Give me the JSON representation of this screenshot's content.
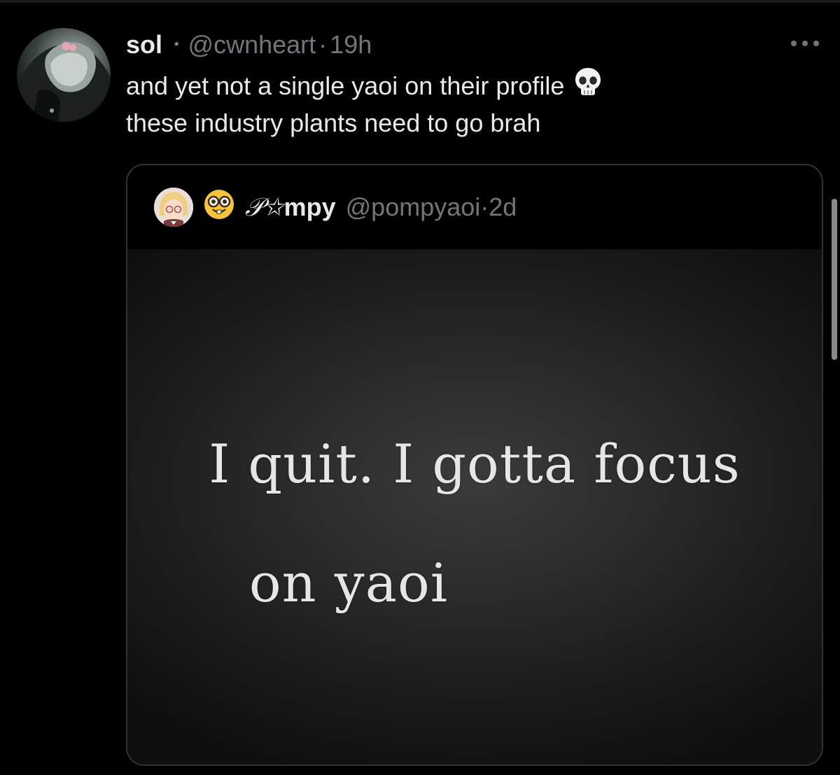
{
  "tweet": {
    "display_name": "sol",
    "name_badge": "⋆",
    "handle": "@cwnheart",
    "separator": "·",
    "timestamp": "19h",
    "text_line_1": "and yet not a single yaoi on their profile",
    "text_line_2": "these industry plants need to go brah",
    "emoji": "skull-icon",
    "more_icon": "more-icon"
  },
  "quote": {
    "emoji": "nerd-face-icon",
    "display_name_script": "𝒫",
    "display_name_star": "✩",
    "display_name_rest": "mpy",
    "handle": "@pompyaoi",
    "separator": "·",
    "timestamp": "2d",
    "image_text_line_1": "I quit. I gotta focus",
    "image_text_line_2": "on yaoi"
  },
  "colors": {
    "background": "#000000",
    "text_primary": "#e7e9ea",
    "text_secondary": "#71767b",
    "card_border": "#2f3336"
  }
}
